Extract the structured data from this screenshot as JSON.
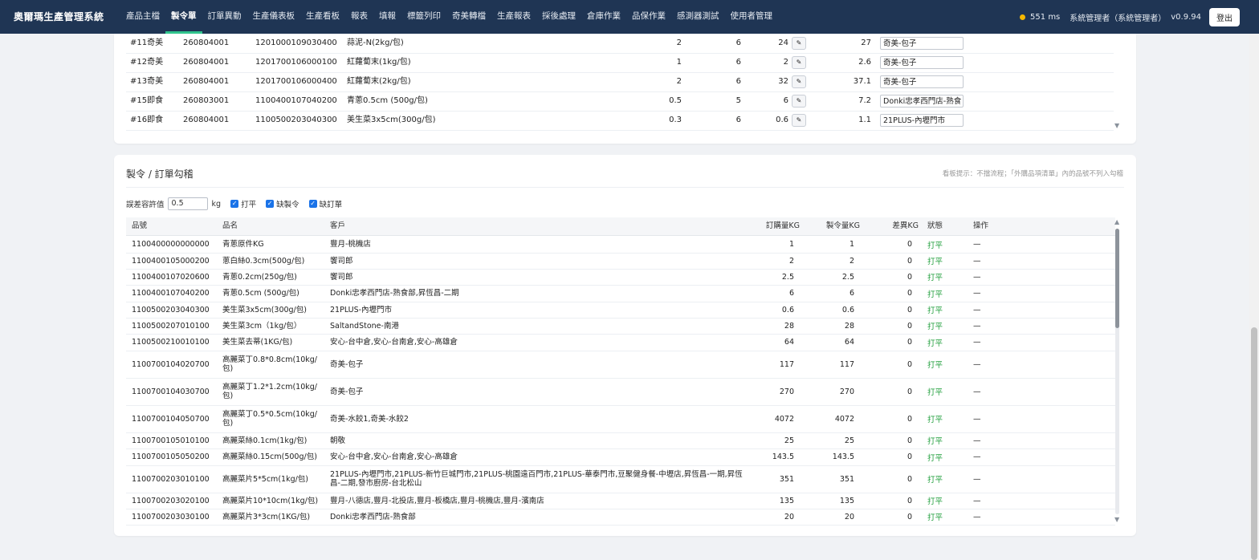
{
  "app": {
    "title": "奧爾瑪生產管理系統"
  },
  "nav": [
    {
      "label": "產品主檔"
    },
    {
      "label": "製令單",
      "active": true
    },
    {
      "label": "訂單異動"
    },
    {
      "label": "生產儀表板"
    },
    {
      "label": "生產看板"
    },
    {
      "label": "報表"
    },
    {
      "label": "填報"
    },
    {
      "label": "標籤列印"
    },
    {
      "label": "奇美轉檔"
    },
    {
      "label": "生產報表"
    },
    {
      "label": "採後處理"
    },
    {
      "label": "倉庫作業"
    },
    {
      "label": "品保作業"
    },
    {
      "label": "感測器測試"
    },
    {
      "label": "使用者管理"
    }
  ],
  "status": {
    "latency": "551 ms",
    "user": "系統管理者（系統管理者）",
    "version": "v0.9.94",
    "logout_label": "登出",
    "dot_color": "#f5b800"
  },
  "top_table": {
    "rows": [
      {
        "id": "#11奇美",
        "order": "260804001",
        "code": "1201000109030400",
        "name": "蒜泥-N(2kg/包)",
        "a": "2",
        "b": "6",
        "c": "24",
        "d": "27",
        "customer": "奇美-包子"
      },
      {
        "id": "#12奇美",
        "order": "260804001",
        "code": "1201700106000100",
        "name": "紅蘿蔔末(1kg/包)",
        "a": "1",
        "b": "6",
        "c": "2",
        "d": "2.6",
        "customer": "奇美-包子"
      },
      {
        "id": "#13奇美",
        "order": "260804001",
        "code": "1201700106000400",
        "name": "紅蘿蔔末(2kg/包)",
        "a": "2",
        "b": "6",
        "c": "32",
        "d": "37.1",
        "customer": "奇美-包子"
      },
      {
        "id": "#15即食",
        "order": "260803001",
        "code": "1100400107040200",
        "name": "青蔥0.5cm (500g/包)",
        "a": "0.5",
        "b": "5",
        "c": "6",
        "d": "7.2",
        "customer": "Donki忠孝西門店-熟食"
      },
      {
        "id": "#16即食",
        "order": "260804001",
        "code": "1100500203040300",
        "name": "美生菜3x5cm(300g/包)",
        "a": "0.3",
        "b": "6",
        "c": "0.6",
        "d": "1.1",
        "customer": "21PLUS-內壢門市"
      }
    ]
  },
  "section": {
    "title": "製令 / 訂單勾稽",
    "hint": "看板提示：不擋流程；「外購品項清單」內的品號不列入勾稽",
    "tolerance_label": "誤差容許值",
    "tolerance_value": "0.5",
    "unit": "kg",
    "checkboxes": [
      {
        "label": "打平"
      },
      {
        "label": "缺製令"
      },
      {
        "label": "缺訂單"
      }
    ]
  },
  "check_table": {
    "headers": {
      "code": "品號",
      "name": "品名",
      "customer": "客戶",
      "order_kg": "訂購量KG",
      "make_kg": "製令量KG",
      "diff_kg": "差異KG",
      "status": "狀態",
      "action": "操作"
    },
    "rows": [
      {
        "code": "1100400000000000",
        "name": "青蔥原件KG",
        "customer": "豐月-桃機店",
        "order_kg": "1",
        "make_kg": "1",
        "diff_kg": "0",
        "status": "打平",
        "action": "—"
      },
      {
        "code": "1100400105000200",
        "name": "蔥白絲0.3cm(500g/包)",
        "customer": "饗司郎",
        "order_kg": "2",
        "make_kg": "2",
        "diff_kg": "0",
        "status": "打平",
        "action": "—"
      },
      {
        "code": "1100400107020600",
        "name": "青蔥0.2cm(250g/包)",
        "customer": "饗司郎",
        "order_kg": "2.5",
        "make_kg": "2.5",
        "diff_kg": "0",
        "status": "打平",
        "action": "—"
      },
      {
        "code": "1100400107040200",
        "name": "青蔥0.5cm (500g/包)",
        "customer": "Donki忠孝西門店-熟食部,昇恆昌-二期",
        "order_kg": "6",
        "make_kg": "6",
        "diff_kg": "0",
        "status": "打平",
        "action": "—"
      },
      {
        "code": "1100500203040300",
        "name": "美生菜3x5cm(300g/包)",
        "customer": "21PLUS-內壢門市",
        "order_kg": "0.6",
        "make_kg": "0.6",
        "diff_kg": "0",
        "status": "打平",
        "action": "—"
      },
      {
        "code": "1100500207010100",
        "name": "美生菜3cm（1kg/包）",
        "customer": "SaltandStone-南港",
        "order_kg": "28",
        "make_kg": "28",
        "diff_kg": "0",
        "status": "打平",
        "action": "—"
      },
      {
        "code": "1100500210010100",
        "name": "美生菜去蒂(1KG/包)",
        "customer": "安心-台中倉,安心-台南倉,安心-高雄倉",
        "order_kg": "64",
        "make_kg": "64",
        "diff_kg": "0",
        "status": "打平",
        "action": "—"
      },
      {
        "code": "1100700104020700",
        "name": "高麗菜丁0.8*0.8cm(10kg/包)",
        "customer": "奇美-包子",
        "order_kg": "117",
        "make_kg": "117",
        "diff_kg": "0",
        "status": "打平",
        "action": "—"
      },
      {
        "code": "1100700104030700",
        "name": "高麗菜丁1.2*1.2cm(10kg/包)",
        "customer": "奇美-包子",
        "order_kg": "270",
        "make_kg": "270",
        "diff_kg": "0",
        "status": "打平",
        "action": "—"
      },
      {
        "code": "1100700104050700",
        "name": "高麗菜丁0.5*0.5cm(10kg/包)",
        "customer": "奇美-水餃1,奇美-水餃2",
        "order_kg": "4072",
        "make_kg": "4072",
        "diff_kg": "0",
        "status": "打平",
        "action": "—"
      },
      {
        "code": "1100700105010100",
        "name": "高麗菜絲0.1cm(1kg/包)",
        "customer": "朝敬",
        "order_kg": "25",
        "make_kg": "25",
        "diff_kg": "0",
        "status": "打平",
        "action": "—"
      },
      {
        "code": "1100700105050200",
        "name": "高麗菜絲0.15cm(500g/包)",
        "customer": "安心-台中倉,安心-台南倉,安心-高雄倉",
        "order_kg": "143.5",
        "make_kg": "143.5",
        "diff_kg": "0",
        "status": "打平",
        "action": "—"
      },
      {
        "code": "1100700203010100",
        "name": "高麗菜片5*5cm(1kg/包)",
        "customer": "21PLUS-內壢門市,21PLUS-新竹巨城門市,21PLUS-桃園遠百門市,21PLUS-華泰門市,豆聚健身餐-中壢店,昇恆昌-一期,昇恆昌-二期,發市廚房-台北松山",
        "order_kg": "351",
        "make_kg": "351",
        "diff_kg": "0",
        "status": "打平",
        "action": "—"
      },
      {
        "code": "1100700203020100",
        "name": "高麗菜片10*10cm(1kg/包)",
        "customer": "豐月-八德店,豐月-北投店,豐月-板橋店,豐月-桃機店,豐月-濱南店",
        "order_kg": "135",
        "make_kg": "135",
        "diff_kg": "0",
        "status": "打平",
        "action": "—"
      },
      {
        "code": "1100700203030100",
        "name": "高麗菜片3*3cm(1KG/包)",
        "customer": "Donki忠孝西門店-熟食部",
        "order_kg": "20",
        "make_kg": "20",
        "diff_kg": "0",
        "status": "打平",
        "action": "—"
      }
    ]
  },
  "colors": {
    "topbar": "#1f3554",
    "accent": "#31c48d",
    "ok": "#1e9e3a",
    "checkbox": "#1a73e8"
  },
  "icons": {
    "edit": "pencil-icon",
    "scroll_up": "triangle-up-icon",
    "scroll_down": "triangle-down-icon",
    "status": "status-dot-icon"
  }
}
